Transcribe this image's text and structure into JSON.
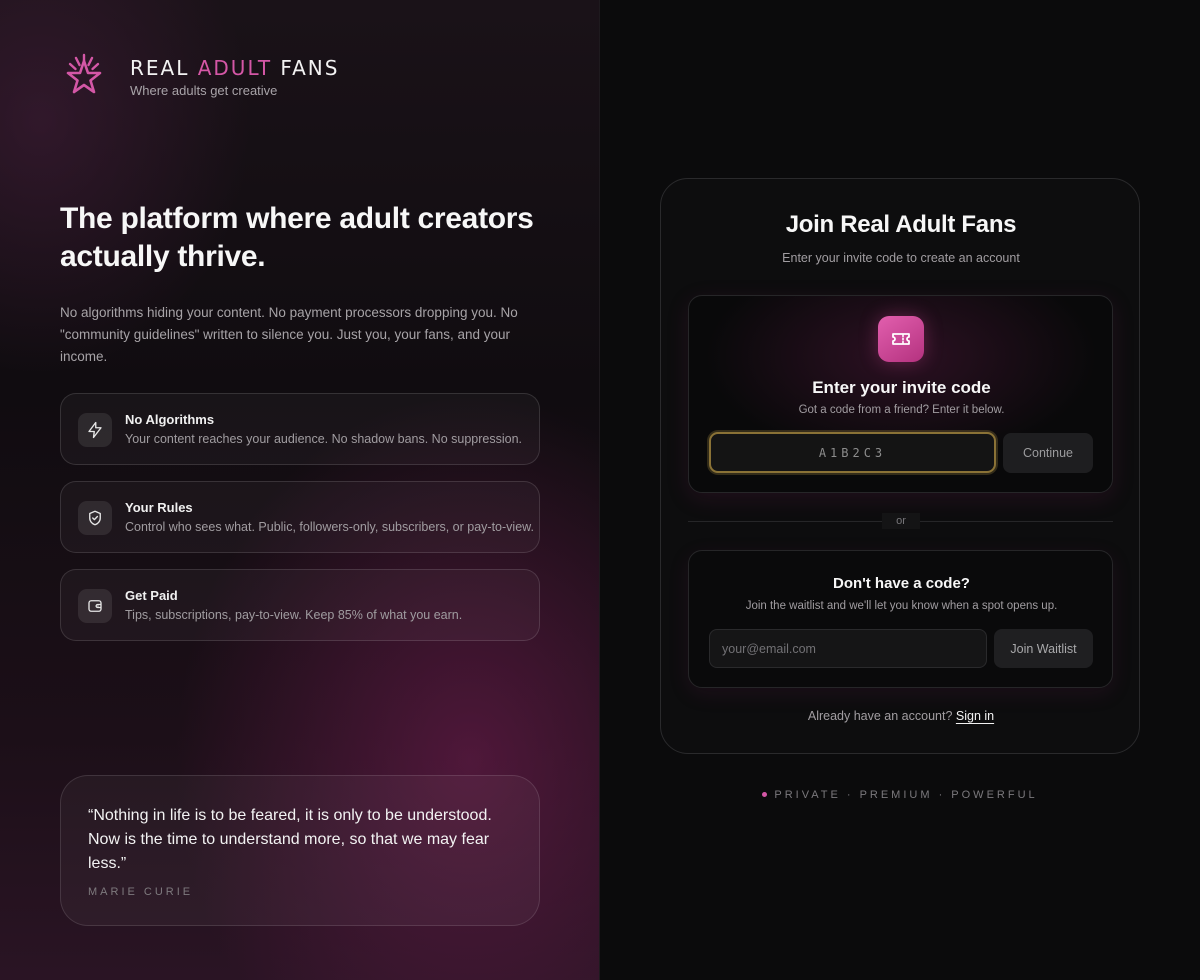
{
  "brand": {
    "name_part1": "REAL ",
    "name_accent": "ADULT",
    "name_part2": " FANS",
    "tagline": "Where adults get creative",
    "logo_icon": "star-icon",
    "accent_color": "#d457a6"
  },
  "hero": {
    "title": "The platform where adult creators actually thrive.",
    "description": "No algorithms hiding your content. No payment processors dropping you. No \"community guidelines\" written to silence you. Just you, your fans, and your income."
  },
  "features": [
    {
      "icon": "lightning-icon",
      "title": "No Algorithms",
      "description": "Your content reaches your audience. No shadow bans. No suppression."
    },
    {
      "icon": "shield-check-icon",
      "title": "Your Rules",
      "description": "Control who sees what. Public, followers-only, subscribers, or pay-to-view."
    },
    {
      "icon": "wallet-icon",
      "title": "Get Paid",
      "description": "Tips, subscriptions, pay-to-view. Keep 85% of what you earn."
    }
  ],
  "quote": {
    "text": "“Nothing in life is to be feared, it is only to be understood. Now is the time to understand more, so that we may fear less.”",
    "author": "MARIE CURIE"
  },
  "join": {
    "title": "Join Real Adult Fans",
    "subtitle": "Enter your invite code to create an account",
    "invite": {
      "icon": "ticket-icon",
      "title": "Enter your invite code",
      "subtitle": "Got a code from a friend? Enter it below.",
      "placeholder": "A1B2C3",
      "button": "Continue"
    },
    "divider": "or",
    "waitlist": {
      "title": "Don't have a code?",
      "subtitle": "Join the waitlist and we'll let you know when a spot opens up.",
      "placeholder": "your@email.com",
      "button": "Join Waitlist"
    },
    "signin_prompt": "Already have an account?",
    "signin_link": "Sign in"
  },
  "footer": {
    "tagline": "PRIVATE · PREMIUM · POWERFUL"
  }
}
